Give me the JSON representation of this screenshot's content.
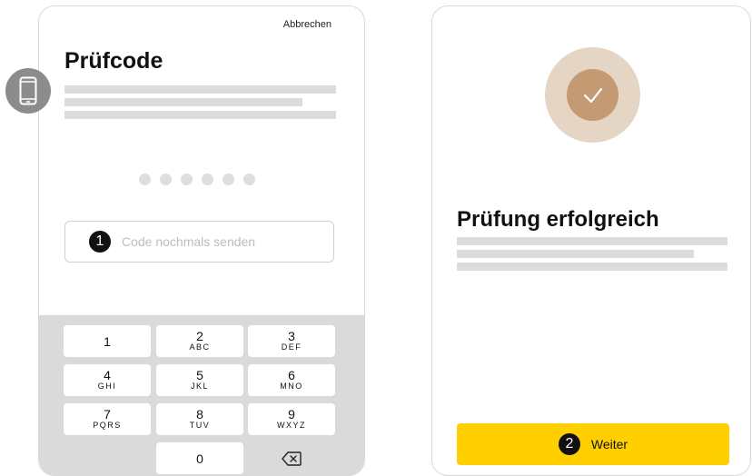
{
  "verification_screen": {
    "cancel_label": "Abbrechen",
    "title": "Prüfcode",
    "code_dot_count": 6,
    "resend": {
      "step_number": "1",
      "label": "Code nochmals senden"
    },
    "icon": "smartphone-icon",
    "keypad": [
      {
        "digit": "1",
        "letters": ""
      },
      {
        "digit": "2",
        "letters": "ABC"
      },
      {
        "digit": "3",
        "letters": "DEF"
      },
      {
        "digit": "4",
        "letters": "GHI"
      },
      {
        "digit": "5",
        "letters": "JKL"
      },
      {
        "digit": "6",
        "letters": "MNO"
      },
      {
        "digit": "7",
        "letters": "PQRS"
      },
      {
        "digit": "8",
        "letters": "TUV"
      },
      {
        "digit": "9",
        "letters": "WXYZ"
      },
      {
        "digit": "0",
        "letters": ""
      }
    ],
    "backspace_icon": "backspace-icon"
  },
  "success_screen": {
    "check_icon": "checkmark-icon",
    "title": "Prüfung erfolgreich",
    "continue": {
      "step_number": "2",
      "label": "Weiter"
    }
  },
  "colors": {
    "accent_yellow": "#ffcf00",
    "check_outer": "#e5d5c4",
    "check_inner": "#c49a72",
    "keypad_bg": "#d9dad9",
    "placeholder_line": "#dcdcdc",
    "phone_badge": "#8c8c8c"
  }
}
